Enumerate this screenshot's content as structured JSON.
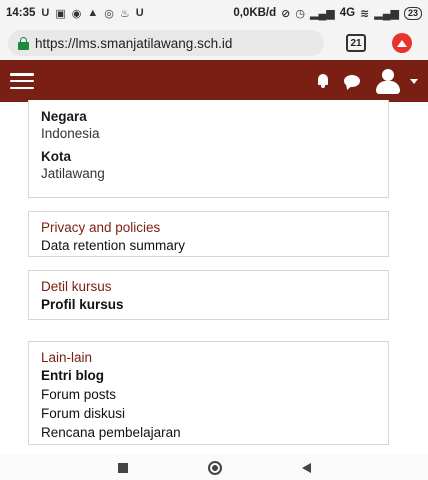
{
  "status_bar": {
    "time": "14:35",
    "left_glyphs": [
      "U",
      "▣",
      "◉",
      "▲",
      "◎",
      "♨",
      "U"
    ],
    "speed": "0,0KB/d",
    "network": "4G",
    "battery": "23"
  },
  "browser": {
    "url": "https://lms.smanjatilawang.sch.id",
    "tab_count": "21"
  },
  "profile": {
    "country_label": "Negara",
    "country_value": "Indonesia",
    "city_label": "Kota",
    "city_value": "Jatilawang"
  },
  "privacy": {
    "title": "Privacy and policies",
    "link": "Data retention summary"
  },
  "course": {
    "title": "Detil kursus",
    "link": "Profil kursus"
  },
  "misc": {
    "title": "Lain-lain",
    "links": [
      "Entri blog",
      "Forum posts",
      "Forum diskusi",
      "Rencana pembelajaran"
    ]
  },
  "colors": {
    "navbar": "#7a1f14",
    "section_title": "#7a1f14",
    "lock": "#1b8a3b",
    "opera": "#e8322e"
  }
}
